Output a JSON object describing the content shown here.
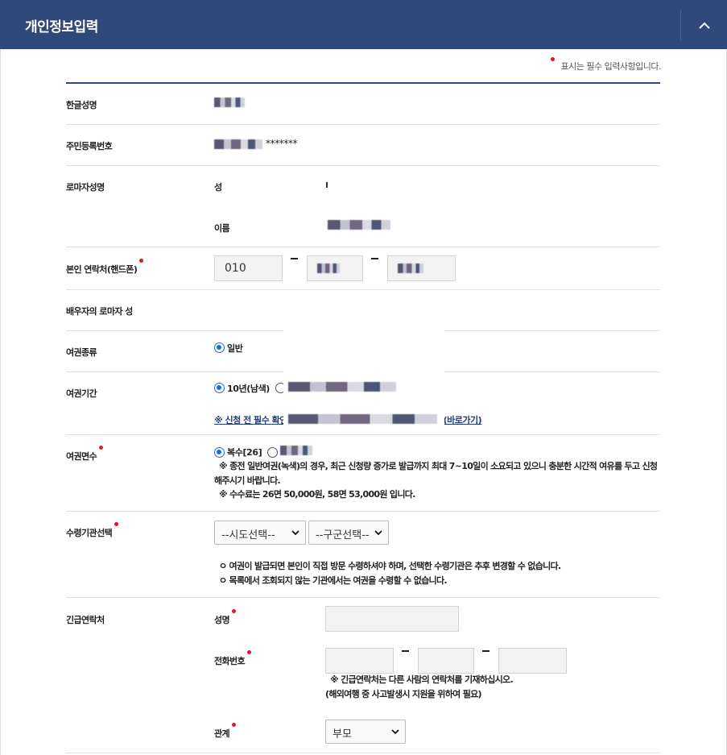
{
  "header": {
    "title": "개인정보입력"
  },
  "required_note": "표시는 필수 입력사항입니다.",
  "fields": {
    "korean_name": {
      "label": "한글성명"
    },
    "rrn": {
      "label": "주민등록번호",
      "masked_suffix": "*******"
    },
    "roman_name": {
      "label": "로마자성명",
      "surname_label": "성",
      "given_label": "이름",
      "surname_value": ""
    },
    "phone": {
      "label": "본인 연락처(핸드폰)",
      "prefix": "010"
    },
    "spouse_roman": {
      "label": "배우자의 로마자 성"
    },
    "passport_type": {
      "label": "여권종류",
      "option_selected": "일반"
    },
    "passport_period": {
      "label": "여권기간",
      "option_selected": "10년(남색)",
      "link_start": "※ 신청 전 필수 확인",
      "link_end": "내(바로가기)"
    },
    "pages": {
      "label": "여권면수",
      "option_selected": "복수[26]",
      "note1": "※ 종전 일반여권(녹색)의 경우, 최근 신청량 증가로 발급까지 최대 7~10일이 소요되고 있으니 충분한 시간적 여유를 두고 신청해주시기 바랍니다.",
      "note2": "※ 수수료는 26면 50,000원, 58면 53,000원 입니다."
    },
    "pickup": {
      "label": "수령기관선택",
      "sido": "--시도선택--",
      "gugun": "--구군선택--",
      "note1": "ㅇ 여권이 발급되면 본인이 직접 방문 수령하셔야 하며, 선택한 수령기관은 추후 변경할 수 없습니다.",
      "note2": "ㅇ 목록에서 조회되지 않는 기관에서는 여권을 수령할 수 없습니다."
    },
    "emergency": {
      "label": "긴급연락처",
      "name_label": "성명",
      "phone_label": "전화번호",
      "relation_label": "관계",
      "relation_value": "부모",
      "phone_note1": "※ 긴급연락처는 다른 사람의 연락처를 기재하십시오.",
      "phone_note2": "(해외여행 중 사고발생시 지원을 위하여 필요)"
    }
  },
  "colors": {
    "header_bg": "#2f4a7a",
    "required_dot": "#e0191e",
    "radio": "#1a6fd6",
    "link": "#1e3d7b"
  }
}
